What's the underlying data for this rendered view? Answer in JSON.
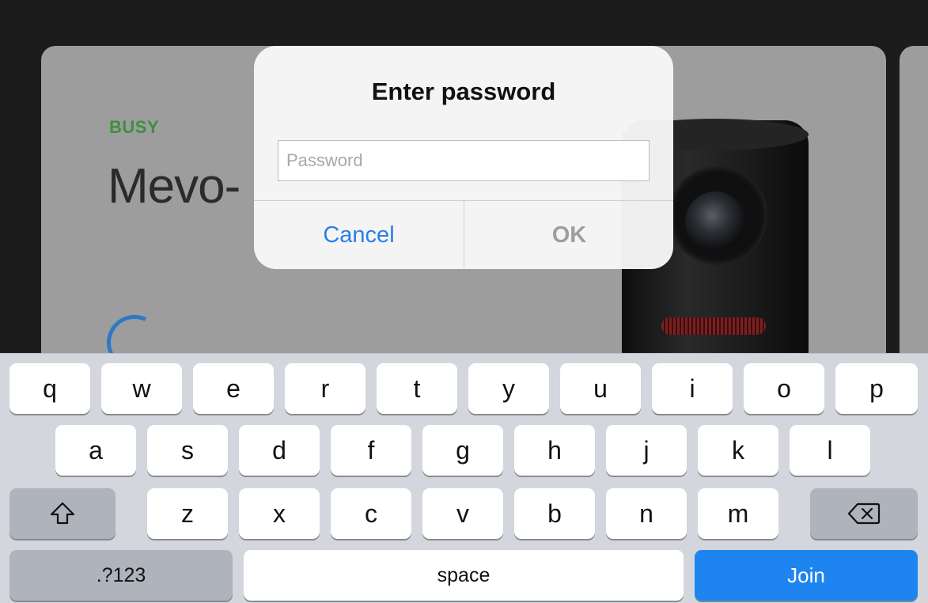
{
  "background_card": {
    "status": "BUSY",
    "device_name": "Mevo-"
  },
  "colors": {
    "status_green": "#3e8f3e",
    "accent_blue": "#2a7ee8",
    "join_blue": "#1e85f0"
  },
  "alert": {
    "title": "Enter password",
    "password_placeholder": "Password",
    "password_value": "",
    "cancel_label": "Cancel",
    "ok_label": "OK"
  },
  "keyboard": {
    "row1": [
      "q",
      "w",
      "e",
      "r",
      "t",
      "y",
      "u",
      "i",
      "o",
      "p"
    ],
    "row2": [
      "a",
      "s",
      "d",
      "f",
      "g",
      "h",
      "j",
      "k",
      "l"
    ],
    "row3": [
      "z",
      "x",
      "c",
      "v",
      "b",
      "n",
      "m"
    ],
    "shift_icon": "shift-arrow-icon",
    "backspace_icon": "backspace-icon",
    "numbers_label": ".?123",
    "space_label": "space",
    "join_label": "Join"
  }
}
